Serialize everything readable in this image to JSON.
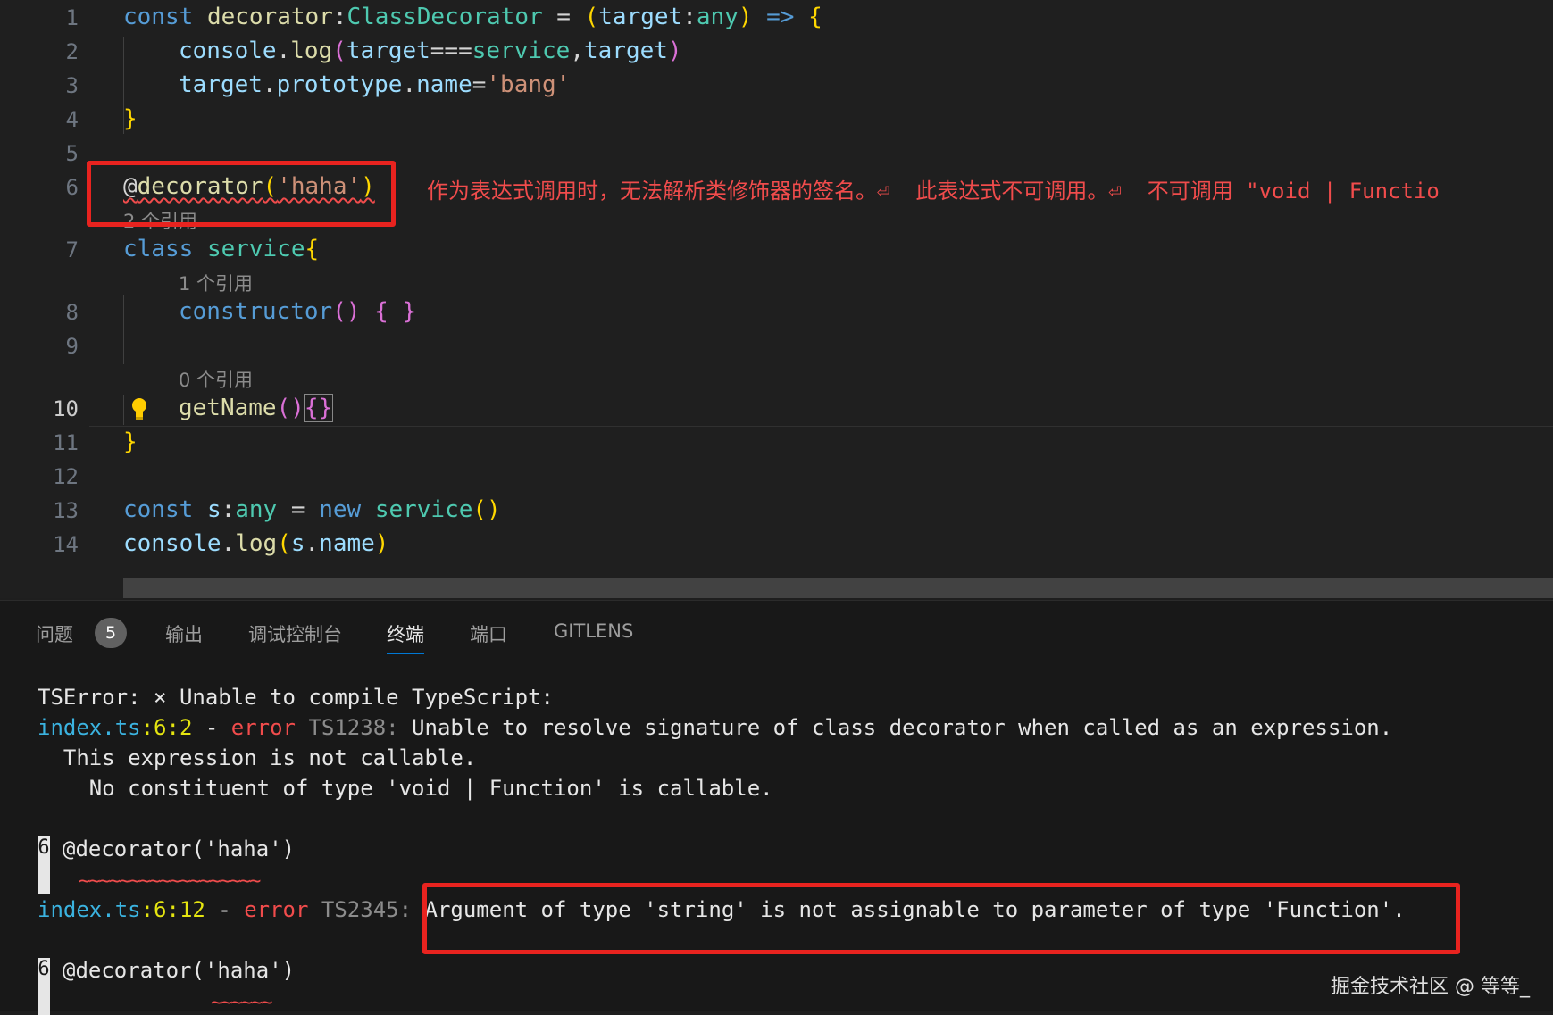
{
  "editor": {
    "line_numbers": [
      "1",
      "2",
      "3",
      "4",
      "5",
      "6",
      "7",
      "8",
      "9",
      "10",
      "11",
      "12",
      "13",
      "14"
    ],
    "active_line": "10",
    "lines": {
      "l1": [
        "const",
        " ",
        "decorator",
        ":",
        "ClassDecorator",
        " = ",
        "(",
        "target",
        ":",
        "any",
        ")",
        " => ",
        "{"
      ],
      "l2": [
        "console",
        ".",
        "log",
        "(",
        "target",
        "===",
        "service",
        ",",
        "target",
        ")"
      ],
      "l3": [
        "target",
        ".",
        "prototype",
        ".",
        "name",
        "=",
        "'bang'"
      ],
      "l4": [
        "}"
      ],
      "l6": [
        "@",
        "decorator",
        "(",
        "'haha'",
        ")"
      ],
      "l7": [
        "class",
        " ",
        "service",
        "{"
      ],
      "l8": [
        "constructor",
        "()",
        " ",
        "{",
        " ",
        "}"
      ],
      "l10": [
        "getName",
        "()",
        "{}"
      ],
      "l11": [
        "}"
      ],
      "l13": [
        "const",
        " ",
        "s",
        ":",
        "any",
        " = ",
        "new",
        " ",
        "service",
        "()"
      ],
      "l14": [
        "console",
        ".",
        "log",
        "(",
        "s",
        ".",
        "name",
        ")"
      ]
    },
    "codelens": {
      "class_refs": "2 个引用",
      "ctor_refs": "1 个引用",
      "getname_refs": "0 个引用"
    },
    "inline_error": "作为表达式调用时，无法解析类修饰器的签名。⏎  此表达式不可调用。⏎  不可调用 \"void | Functio"
  },
  "panel": {
    "tabs": {
      "problems": "问题",
      "problems_count": "5",
      "output": "输出",
      "debug_console": "调试控制台",
      "terminal": "终端",
      "ports": "端口",
      "gitlens": "GITLENS"
    },
    "terminal": {
      "line1": "TSError: × Unable to compile TypeScript:",
      "err1_file": "index.ts",
      "err1_pos": ":6:2",
      "err1_dash": " - ",
      "err1_word": "error",
      "err1_code": " TS1238:",
      "err1_msg": " Unable to resolve signature of class decorator when called as an expression.",
      "err1_cont1": "  This expression is not callable.",
      "err1_cont2": "    No constituent of type 'void | Function' is callable.",
      "snippet_lineno": "6",
      "snippet_code": "@decorator('haha')",
      "snippet_tilde1": "~~~~~~~~~~~~~~~~~~",
      "err2_file": "index.ts",
      "err2_pos": ":6:12",
      "err2_dash": " - ",
      "err2_word": "error",
      "err2_code": " TS2345:",
      "err2_msg": " Argument of type 'string' is not assignable to parameter of type 'Function'.",
      "snippet2_lineno": "6",
      "snippet2_code": "@decorator('haha')",
      "snippet_tilde2": "~~~~~~"
    }
  },
  "watermark": "掘金技术社区 @ 等等_"
}
